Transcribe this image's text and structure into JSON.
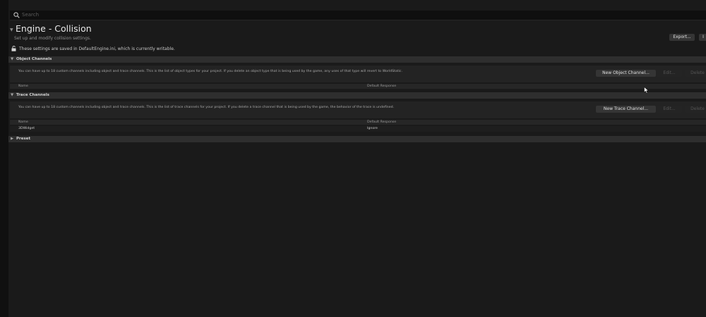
{
  "search": {
    "placeholder": "Search"
  },
  "page": {
    "title": "Engine - Collision",
    "subtitle": "Set up and modify collision settings.",
    "saved_notice": "These settings are saved in DefaultEngine.ini, which is currently writable."
  },
  "toolbar": {
    "export_label": "Export...",
    "import_label": "I"
  },
  "object_channels": {
    "header": "Object Channels",
    "description": "You can have up to 18 custom channels including object and trace channels. This is the list of object types for your project. If you delete an object type that is being used by the game, any uses of that type will revert to WorldStatic.",
    "new_label": "New Object Channel...",
    "edit_label": "Edit...",
    "delete_label": "Delete",
    "columns": {
      "name": "Name",
      "default_response": "Default Response"
    },
    "rows": []
  },
  "trace_channels": {
    "header": "Trace Channels",
    "description": "You can have up to 18 custom channels including object and trace channels. This is the list of trace channels for your project. If you delete a trace channel that is being used by the game, the behavior of the trace is undefined.",
    "new_label": "New Trace Channel...",
    "edit_label": "Edit...",
    "delete_label": "Delete",
    "columns": {
      "name": "Name",
      "default_response": "Default Response"
    },
    "rows": [
      {
        "name": "3DWidget",
        "default_response": "Ignore"
      }
    ]
  },
  "preset": {
    "header": "Preset"
  },
  "colors": {
    "background": "#1a1a1a",
    "section_header": "#2e2e2e",
    "button": "#353535"
  },
  "icons": {
    "search": "search-icon",
    "lock": "unlock-icon",
    "expand": "triangle-down-icon",
    "collapse": "triangle-right-icon"
  }
}
